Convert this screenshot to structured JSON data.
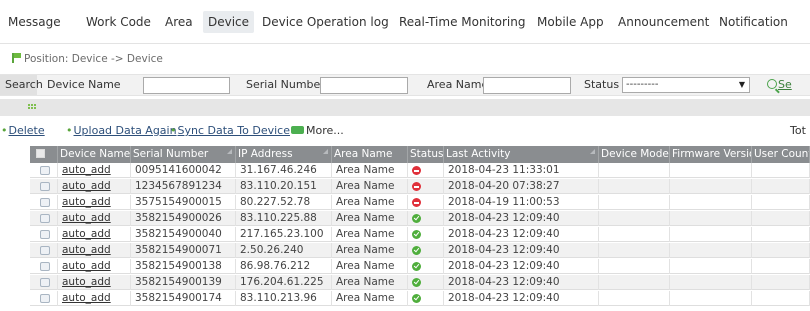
{
  "nav": {
    "tabs": [
      {
        "label": "Message"
      },
      {
        "label": "Work Code"
      },
      {
        "label": "Area"
      },
      {
        "label": "Device",
        "active": true
      },
      {
        "label": "Device Operation log"
      },
      {
        "label": "Real-Time Monitoring"
      },
      {
        "label": "Mobile App"
      },
      {
        "label": "Announcement"
      },
      {
        "label": "Notification"
      }
    ]
  },
  "breadcrumb": "Position: Device -> Device",
  "search": {
    "tag": "Search",
    "device_name_label": "Device Name",
    "device_name_value": "",
    "serial_number_label": "Serial Number",
    "serial_number_value": "",
    "area_name_label": "Area Name",
    "area_name_value": "",
    "status_label": "Status",
    "status_value": "---------",
    "search_button_label": "Se"
  },
  "actions": {
    "delete": "Delete",
    "upload": "Upload Data Again",
    "sync": "Sync Data To Device",
    "more": "More...",
    "total": "Tot"
  },
  "table": {
    "columns": [
      "Device Name",
      "Serial Number",
      "IP Address",
      "Area Name",
      "Status",
      "Last Activity",
      "Device Model",
      "Firmware Version",
      "User Count"
    ],
    "rows": [
      {
        "name": "auto_add",
        "serial": "0095141600042",
        "ip": "31.167.46.246",
        "area": "Area Name",
        "status": "offline",
        "last": "2018-04-23 11:33:01"
      },
      {
        "name": "auto_add",
        "serial": "1234567891234",
        "ip": "83.110.20.151",
        "area": "Area Name",
        "status": "offline",
        "last": "2018-04-20 07:38:27"
      },
      {
        "name": "auto_add",
        "serial": "3575154900015",
        "ip": "80.227.52.78",
        "area": "Area Name",
        "status": "offline",
        "last": "2018-04-19 11:00:53"
      },
      {
        "name": "auto_add",
        "serial": "3582154900026",
        "ip": "83.110.225.88",
        "area": "Area Name",
        "status": "online",
        "last": "2018-04-23 12:09:40"
      },
      {
        "name": "auto_add",
        "serial": "3582154900040",
        "ip": "217.165.23.100",
        "area": "Area Name",
        "status": "online",
        "last": "2018-04-23 12:09:40"
      },
      {
        "name": "auto_add",
        "serial": "3582154900071",
        "ip": "2.50.26.240",
        "area": "Area Name",
        "status": "online",
        "last": "2018-04-23 12:09:40"
      },
      {
        "name": "auto_add",
        "serial": "3582154900138",
        "ip": "86.98.76.212",
        "area": "Area Name",
        "status": "online",
        "last": "2018-04-23 12:09:40"
      },
      {
        "name": "auto_add",
        "serial": "3582154900139",
        "ip": "176.204.61.225",
        "area": "Area Name",
        "status": "online",
        "last": "2018-04-23 12:09:40"
      },
      {
        "name": "auto_add",
        "serial": "3582154900174",
        "ip": "83.110.213.96",
        "area": "Area Name",
        "status": "online",
        "last": "2018-04-23 12:09:40"
      }
    ]
  }
}
